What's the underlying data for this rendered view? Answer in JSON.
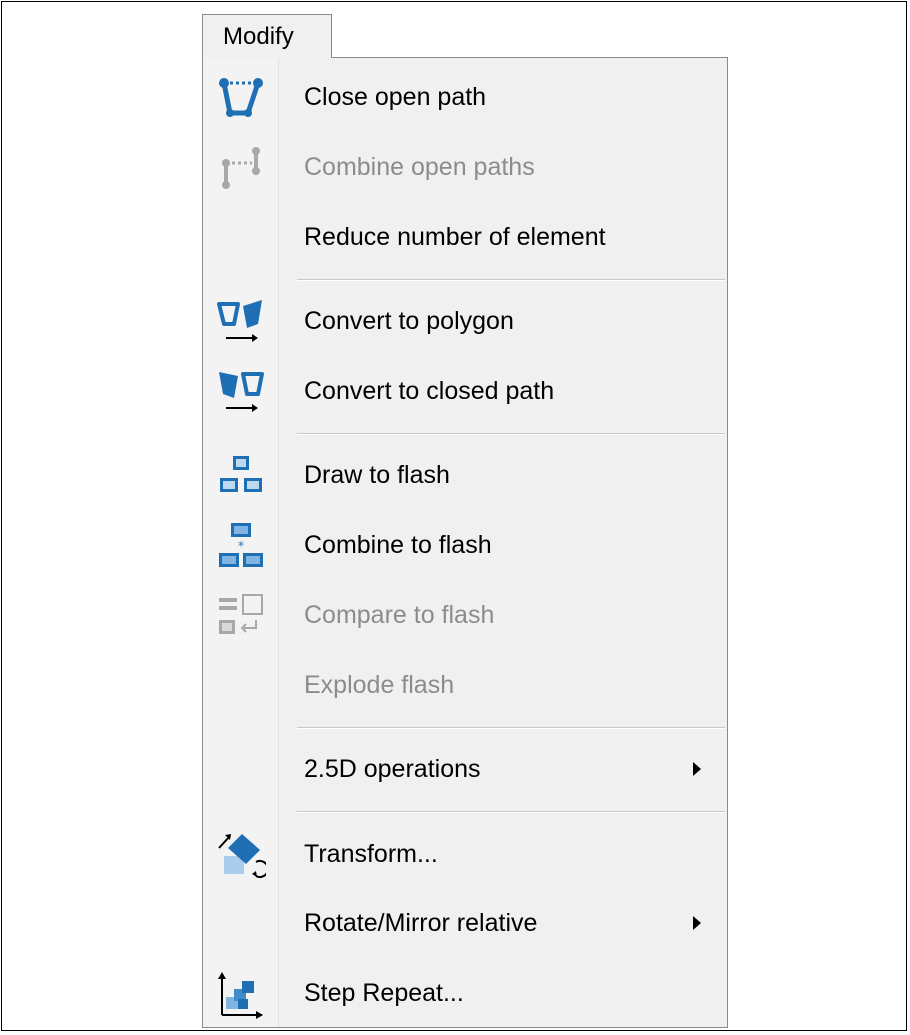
{
  "menu": {
    "title": "Modify",
    "items": [
      {
        "label": "Close open path",
        "icon": "close-path-icon",
        "enabled": true
      },
      {
        "label": "Combine open paths",
        "icon": "combine-paths-icon",
        "enabled": false
      },
      {
        "label": "Reduce number of element",
        "icon": "",
        "enabled": true
      },
      {
        "label": "Convert to polygon",
        "icon": "convert-polygon-icon",
        "enabled": true
      },
      {
        "label": "Convert to closed path",
        "icon": "convert-closed-path-icon",
        "enabled": true
      },
      {
        "label": "Draw to flash",
        "icon": "draw-to-flash-icon",
        "enabled": true
      },
      {
        "label": "Combine to flash",
        "icon": "combine-to-flash-icon",
        "enabled": true
      },
      {
        "label": "Compare to flash",
        "icon": "compare-to-flash-icon",
        "enabled": false
      },
      {
        "label": "Explode flash",
        "icon": "",
        "enabled": false
      },
      {
        "label": "2.5D operations",
        "icon": "",
        "enabled": true,
        "submenu": true
      },
      {
        "label": "Transform...",
        "icon": "transform-icon",
        "enabled": true
      },
      {
        "label": "Rotate/Mirror relative",
        "icon": "",
        "enabled": true,
        "submenu": true
      },
      {
        "label": "Step  Repeat...",
        "icon": "step-repeat-icon",
        "enabled": true
      }
    ]
  },
  "colors": {
    "menu_background": "#f0f0f0",
    "text": "#000000",
    "disabled_text": "#8c8c8c",
    "icon_blue": "#1f6fb5"
  }
}
